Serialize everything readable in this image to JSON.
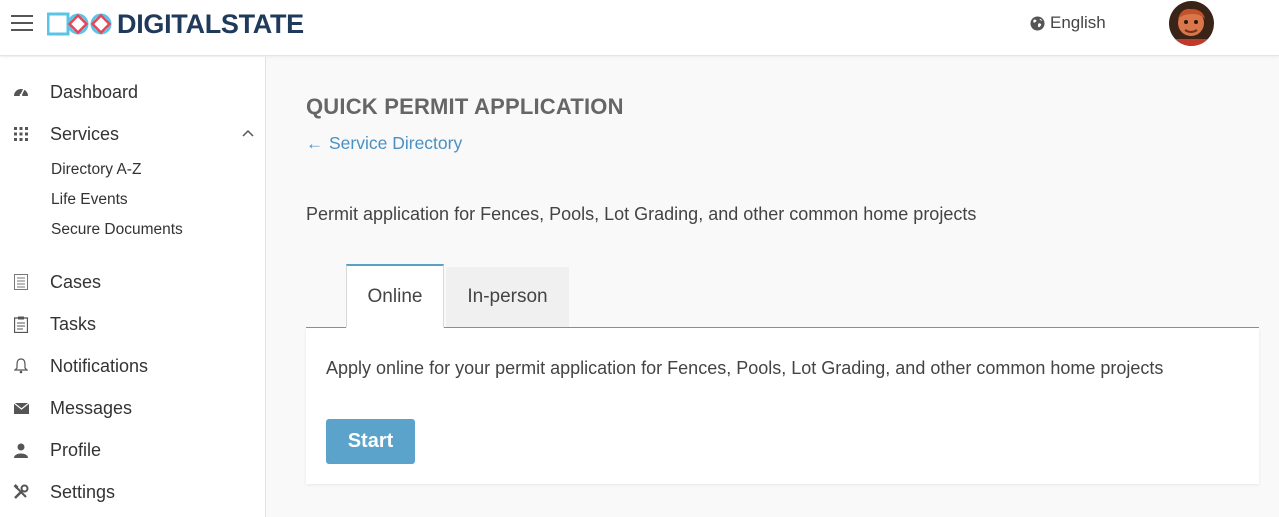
{
  "header": {
    "brand": "DIGITALSTATE",
    "language": "English",
    "icons": {
      "menu": "hamburger-menu-icon",
      "language": "globe-icon",
      "avatar": "user-avatar"
    }
  },
  "sidebar": {
    "items": [
      {
        "label": "Dashboard",
        "icon": "dashboard-gauge-icon"
      },
      {
        "label": "Services",
        "icon": "grid-dots-icon",
        "expanded": true,
        "children": [
          {
            "label": "Directory A-Z"
          },
          {
            "label": "Life Events"
          },
          {
            "label": "Secure Documents"
          }
        ]
      },
      {
        "label": "Cases",
        "icon": "list-icon"
      },
      {
        "label": "Tasks",
        "icon": "clipboard-icon"
      },
      {
        "label": "Notifications",
        "icon": "bell-icon"
      },
      {
        "label": "Messages",
        "icon": "envelope-icon"
      },
      {
        "label": "Profile",
        "icon": "person-icon"
      },
      {
        "label": "Settings",
        "icon": "tools-icon"
      }
    ]
  },
  "main": {
    "title": "QUICK PERMIT APPLICATION",
    "back_link": "Service Directory",
    "description": "Permit application for Fences, Pools, Lot Grading, and other common home projects",
    "tabs": [
      {
        "label": "Online",
        "active": true
      },
      {
        "label": "In-person",
        "active": false
      }
    ],
    "panel": {
      "text": "Apply online for your permit application for Fences, Pools, Lot Grading, and other common home projects",
      "start_label": "Start"
    }
  },
  "colors": {
    "accent": "#5ba3ca",
    "link": "#4a90c2",
    "brand_text": "#1f3a5a",
    "logo_blue": "#5bc4e6",
    "logo_red": "#e8455a"
  }
}
